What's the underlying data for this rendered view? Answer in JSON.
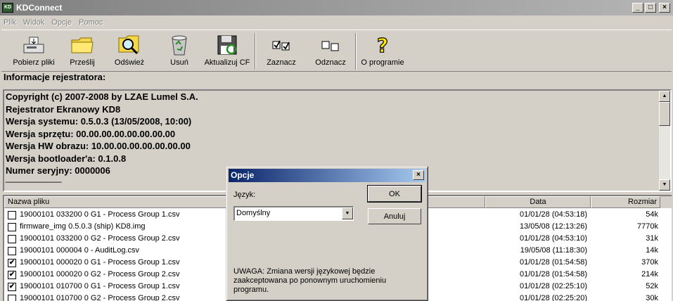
{
  "window": {
    "title": "KDConnect",
    "icon_text": "KD"
  },
  "menu": [
    "Plik",
    "Widok",
    "Opcje",
    "Pomoc"
  ],
  "toolbar": [
    {
      "label": "Pobierz pliki",
      "icon": "download-icon"
    },
    {
      "label": "Prześlij",
      "icon": "folder-icon"
    },
    {
      "label": "Odśwież",
      "icon": "magnifier-icon"
    },
    {
      "label": "Usuń",
      "icon": "recycle-bin-icon"
    },
    {
      "label": "Aktualizuj CF",
      "icon": "floppy-refresh-icon"
    },
    {
      "label": "Zaznacz",
      "icon": "checked-boxes-icon"
    },
    {
      "label": "Odznacz",
      "icon": "unchecked-boxes-icon"
    },
    {
      "label": "O programie",
      "icon": "question-icon"
    }
  ],
  "info": {
    "label": "Informacje rejestratora:",
    "lines": [
      "Copyright (c) 2007-2008 by LZAE Lumel S.A.",
      "Rejestrator Ekranowy KD8",
      "Wersja systemu: 0.5.0.3 (13/05/2008, 10:00)",
      "Wersja sprzętu: 00.00.00.00.00.00.00.00",
      "Wersja HW obrazu: 10.00.00.00.00.00.00.00",
      "Wersja bootloader'a: 0.1.0.8",
      "Numer seryjny: 0000006",
      "___________"
    ]
  },
  "files": {
    "columns": {
      "name": "Nazwa pliku",
      "date": "Data",
      "size": "Rozmiar"
    },
    "rows": [
      {
        "checked": false,
        "name": "19000101 033200 0 G1 - Process Group 1.csv",
        "date": "01/01/28 (04:53:18)",
        "size": "54k"
      },
      {
        "checked": false,
        "name": "firmware_img 0.5.0.3 (ship)  KD8.img",
        "date": "13/05/08 (12:13:26)",
        "size": "7770k"
      },
      {
        "checked": false,
        "name": "19000101 033200 0 G2 - Process Group 2.csv",
        "date": "01/01/28 (04:53:10)",
        "size": "31k"
      },
      {
        "checked": false,
        "name": "19000101 000004 0 - AuditLog.csv",
        "date": "19/05/08 (11:18:30)",
        "size": "14k"
      },
      {
        "checked": true,
        "name": "19000101 000020 0 G1 - Process Group 1.csv",
        "date": "01/01/28 (01:54:58)",
        "size": "370k"
      },
      {
        "checked": true,
        "name": "19000101 000020 0 G2 - Process Group 2.csv",
        "date": "01/01/28 (01:54:58)",
        "size": "214k"
      },
      {
        "checked": true,
        "name": "19000101 010700 0 G1 - Process Group 1.csv",
        "date": "01/01/28 (02:25:10)",
        "size": "52k"
      },
      {
        "checked": false,
        "name": "19000101 010700 0 G2 - Process Group 2.csv",
        "date": "01/01/28 (02:25:20)",
        "size": "30k"
      }
    ]
  },
  "dialog": {
    "title": "Opcje",
    "language_label": "Język:",
    "language_value": "Domyślny",
    "ok": "OK",
    "cancel": "Anuluj",
    "note": "UWAGA: Zmiana wersji językowej będzie zaakceptowana po ponownym uruchomieniu programu."
  },
  "check_mark": "✔",
  "colors": {
    "title_inactive": "#808080",
    "dialog_title": "#0a246a",
    "face": "#d4d0c8"
  }
}
